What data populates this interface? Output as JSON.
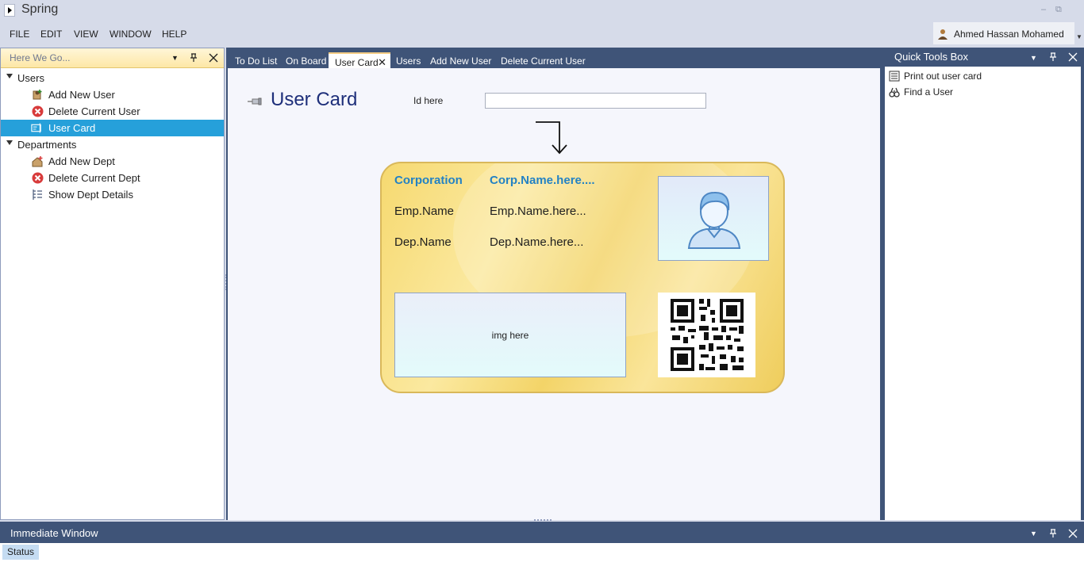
{
  "window": {
    "title": "Spring",
    "minimize": "–",
    "restore": "⧉"
  },
  "menu": [
    "FILE",
    "EDIT",
    "VIEW",
    "WINDOW",
    "HELP"
  ],
  "user": {
    "name": "Ahmed Hassan Mohamed"
  },
  "left_panel": {
    "search_placeholder": "Here We Go...",
    "groups": [
      {
        "label": "Users",
        "items": [
          "Add New User",
          "Delete Current User",
          "User Card"
        ]
      },
      {
        "label": "Departments",
        "items": [
          "Add New Dept",
          "Delete Current Dept",
          "Show Dept Details"
        ]
      }
    ],
    "selected": "User Card"
  },
  "tabs": [
    "To Do List",
    "On Board",
    "User Card",
    "Users",
    "Add New User",
    "Delete Current User"
  ],
  "active_tab": "User Card",
  "page": {
    "title": "User Card",
    "id_label": "Id here",
    "id_value": ""
  },
  "card": {
    "corp_label": "Corporation",
    "corp_value": "Corp.Name.here....",
    "emp_label": "Emp.Name",
    "emp_value": "Emp.Name.here...",
    "dep_label": "Dep.Name",
    "dep_value": "Dep.Name.here...",
    "img_placeholder": "img here"
  },
  "quick_tools": {
    "title": "Quick Tools Box",
    "items": [
      "Print out user card",
      "Find a User"
    ]
  },
  "bottom": {
    "title": "Immediate Window",
    "status_tab": "Status"
  },
  "colors": {
    "accent": "#26a0da",
    "panel_dark": "#3f5478",
    "card_gold": "#f6d970",
    "corp_blue": "#2382c4"
  }
}
